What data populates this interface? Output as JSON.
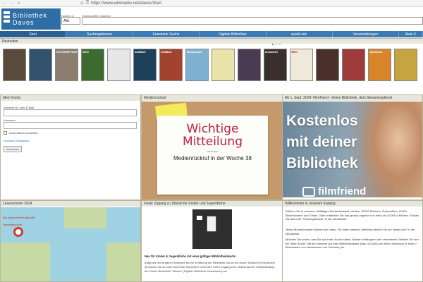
{
  "browser": {
    "url": "https://www.winmedio.net/davos/Start"
  },
  "header": {
    "logo_line1": "Bibliothek",
    "logo_line2": "Davos",
    "search_scope_label": "Suchen in",
    "search_term_label": "Suchbegriffe eingeben",
    "search_scope_value": "Alle"
  },
  "nav": {
    "items": [
      {
        "label": "Start"
      },
      {
        "label": "Suchergebnisse"
      },
      {
        "label": "Erweiterte Suche"
      },
      {
        "label": "Digitale Bibliothek"
      },
      {
        "label": "quickListe"
      },
      {
        "label": "Veranstaltungen"
      },
      {
        "label": "Mein K"
      }
    ]
  },
  "new_releases": {
    "heading": "Neuheiten",
    "covers": [
      {
        "title": "",
        "color": "#5a4a3c"
      },
      {
        "title": "",
        "color": "#33526e"
      },
      {
        "title": "SCHÖNER WOHNEN",
        "color": "#8b7e6e"
      },
      {
        "title": "GEO",
        "color": "#3c6b2f"
      },
      {
        "title": "",
        "color": "#e7e7e7"
      },
      {
        "title": "ANIMAX",
        "color": "#1e3f5a"
      },
      {
        "title": "ANIMAX",
        "color": "#a1432f"
      },
      {
        "title": "Beobachter",
        "color": "#7eb0cf"
      },
      {
        "title": "",
        "color": "#e9e4a9"
      },
      {
        "title": "",
        "color": "#4b3b52"
      },
      {
        "title": "annabelle",
        "color": "#3a2f2c"
      },
      {
        "title": "GEO",
        "color": "#f0e8d8"
      },
      {
        "title": "",
        "color": "#4a2f2a"
      },
      {
        "title": "",
        "color": "#9e3b3b"
      },
      {
        "title": "Spektrum",
        "color": "#d7842b"
      },
      {
        "title": "",
        "color": "#c4a53f"
      }
    ]
  },
  "login": {
    "heading": "Mein Konto",
    "user_label": "Ausweis-Nr. oder E-Mail",
    "password_label": "Kennwort",
    "remember_label": "Automatisch anmelden",
    "forgot_link": "Kennwort vergessen",
    "submit_label": "Anmelden"
  },
  "recall": {
    "heading": "Medienrückruf",
    "title_line1": "Wichtige",
    "title_line2": "Mitteilung",
    "small_text": "YOUR TEXT",
    "subtitle": "Medienrückruf in der Woche 38"
  },
  "filmfriend": {
    "heading": "Ab 1. Sept. 2024: Filmfriend - Deine Bibliothek, dein Streamingdienst",
    "line1": "Kostenlos",
    "line2": "mit deiner",
    "line3": "Bibliothek",
    "brand": "filmfriend"
  },
  "reading_summer": {
    "heading": "Lesesommer 2024",
    "label1": "Wo haben Hexen gesurft?",
    "label2": "Swimming pool"
  },
  "free_access": {
    "heading": "Freier Zugang zu Dibiost für Kinder und Jugendliche",
    "title": "Neu für Kinder & Jugendliche mit einer gültigen Bibliothekskarte:",
    "text": "Aufgrund der längeren Wartezeit bis zur Eröffnung der Bibliothek Davos am neuen Standort (Promenade 45) bieten wir ab sofort bis Ende September 2024 den freien Zugang zum elektronischen Medienkatalog der Online-Bibliothek \"Dibiost\" (Digitale Bibliothek Ostschweiz) an!"
  },
  "welcome": {
    "heading": "Willkommen in unserem Katalog",
    "para1": "Stöbern Sie in unserem vielfältigen Medienbestand mit über 15'000 Büchern, Zeitschriften, DVD's, Bilderbüchern und Tonies. Oder entdecken Sie das grosse Angebot von mehr als 40'000 e-Medien. Klicken Sie dazu auf \"Suchergebnisse\" in der Menüleiste.",
    "para2": "Jeden Monat kommen Medien neu dazu. Für einen raschen Überblick klicken Sie auf \"quickListe\" in der Menüleiste.",
    "para3": "Möchten Sie sehen, was Sie auf Ihrem Konto haben, Medien verlängern oder reservieren? Melden Sie sich bei \"Mein Konto\" mit der Nummer auf Ihrer Bibliothekskarte (Bsp. s15345) und Ihrem Kennwort (4 erste 2 Buchstaben von Nachnamen und Vorname) an."
  }
}
